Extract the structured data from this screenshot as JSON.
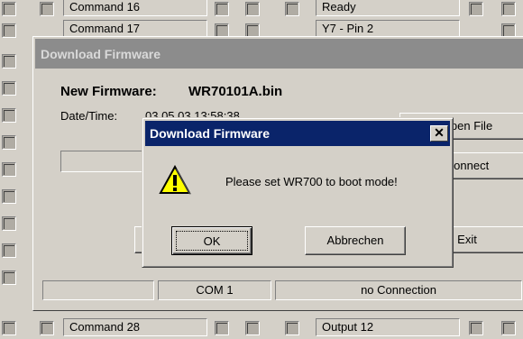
{
  "background": {
    "fields": [
      "Command 16",
      "Ready",
      "Command 17",
      "Y7 - Pin 2",
      "Command 28",
      "Output 12"
    ]
  },
  "dialog": {
    "title": "Download Firmware",
    "new_firmware_label": "New Firmware:",
    "new_firmware_value": "WR70101A.bin",
    "datetime_label": "Date/Time:",
    "datetime_value": "03.05.03 13:58:38",
    "buttons": {
      "open_file": "Open File",
      "connect": "Connect",
      "exit": "Exit"
    },
    "status": {
      "port": "COM 1",
      "connection": "no Connection"
    }
  },
  "message_box": {
    "title": "Download Firmware",
    "close_glyph": "✕",
    "icon": "warning-icon",
    "text": "Please set WR700 to boot mode!",
    "ok_label": "OK",
    "cancel_label": "Abbrechen"
  }
}
